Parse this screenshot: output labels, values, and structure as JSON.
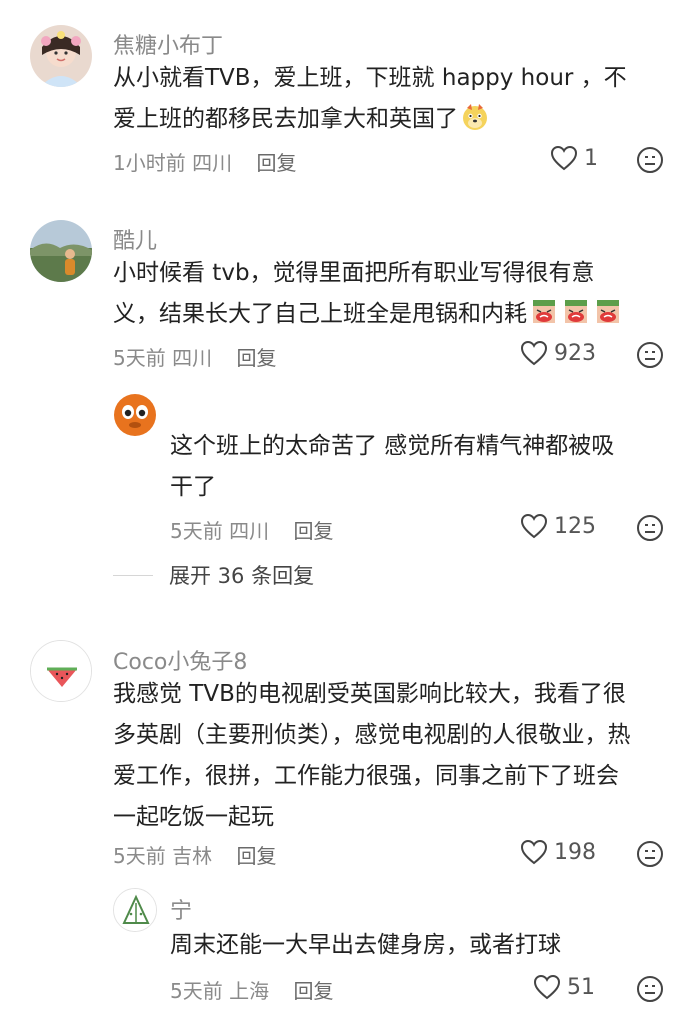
{
  "comments": [
    {
      "username": "焦糖小布丁",
      "lines": [
        "从小就看TVB，爱上班，下班就 happy hour ，不",
        "爱上班的都移民去加拿大和英国了"
      ],
      "time": "1小时前",
      "location": "四川",
      "reply_label": "回复",
      "likes": "1",
      "emojis": [
        "dog-face-emoji"
      ]
    },
    {
      "username": "酷儿",
      "lines": [
        "小时候看 tvb，觉得里面把所有职业写得很有意",
        "义，结果长大了自己上班全是甩锅和内耗"
      ],
      "time": "5天前",
      "location": "四川",
      "reply_label": "回复",
      "likes": "923",
      "emojis": [
        "crying-face-emoji",
        "crying-face-emoji",
        "crying-face-emoji"
      ]
    },
    {
      "username": "",
      "lines": [
        "这个班上的太命苦了 感觉所有精气神都被吸",
        "干了"
      ],
      "time": "5天前",
      "location": "四川",
      "reply_label": "回复",
      "likes": "125"
    },
    {
      "username": "Coco小兔子8",
      "lines": [
        "我感觉 TVB的电视剧受英国影响比较大，我看了很",
        "多英剧（主要刑侦类），感觉电视剧的人很敬业，热",
        "爱工作，很拼，工作能力很强，同事之前下了班会",
        "一起吃饭一起玩"
      ],
      "time": "5天前",
      "location": "吉林",
      "reply_label": "回复",
      "likes": "198"
    },
    {
      "username": "宁",
      "lines": [
        "周末还能一大早出去健身房，或者打球"
      ],
      "time": "5天前",
      "location": "上海",
      "reply_label": "回复",
      "likes": "51"
    }
  ],
  "expand_replies": "展开 36 条回复",
  "colors": {
    "meta_gray": "#8a8a8a",
    "text": "#222222",
    "icon": "#555555"
  }
}
